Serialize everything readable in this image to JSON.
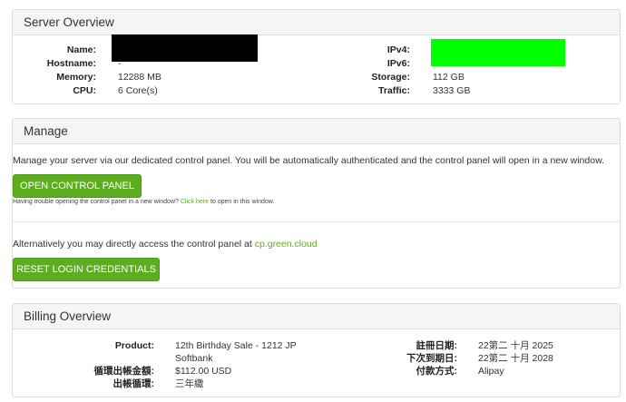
{
  "server": {
    "title": "Server Overview",
    "left": [
      {
        "key": "Name:",
        "value": ""
      },
      {
        "key": "Hostname:",
        "value": "-"
      },
      {
        "key": "Memory:",
        "value": "12288 MB"
      },
      {
        "key": "CPU:",
        "value": "6 Core(s)"
      }
    ],
    "right": [
      {
        "key": "IPv4:",
        "value": ""
      },
      {
        "key": "IPv6:",
        "value": ""
      },
      {
        "key": "Storage:",
        "value": "112 GB"
      },
      {
        "key": "Traffic:",
        "value": "3333 GB"
      }
    ],
    "redaction_colors": {
      "name": "#000000",
      "ip": "#00ff00"
    }
  },
  "manage": {
    "title": "Manage",
    "description": "Manage your server via our dedicated control panel. You will be automatically authenticated and the control panel will open in a new window.",
    "open_button": "OPEN CONTROL PANEL",
    "trouble_prefix": "Having trouble opening the control panel in a new window?",
    "trouble_link": "Click here",
    "trouble_suffix": "to open in this window.",
    "alt_prefix": "Alternatively you may directly access the control panel at",
    "alt_link": "cp.green.cloud",
    "reset_button": "RESET LOGIN CREDENTIALS",
    "accent": "#5cad1f"
  },
  "billing": {
    "title": "Billing Overview",
    "left": [
      {
        "key": "Product:",
        "value": "12th Birthday Sale - 1212 JP"
      },
      {
        "key": "",
        "value": "Softbank"
      },
      {
        "key": "循環出帳金額:",
        "value": "$112.00 USD"
      },
      {
        "key": "出帳循環:",
        "value": "三年繳"
      }
    ],
    "right": [
      {
        "key": "註冊日期:",
        "value": "22第二 十月 2025"
      },
      {
        "key": "下次到期日:",
        "value": "22第二 十月 2028"
      },
      {
        "key": "付款方式:",
        "value": "Alipay"
      }
    ]
  }
}
